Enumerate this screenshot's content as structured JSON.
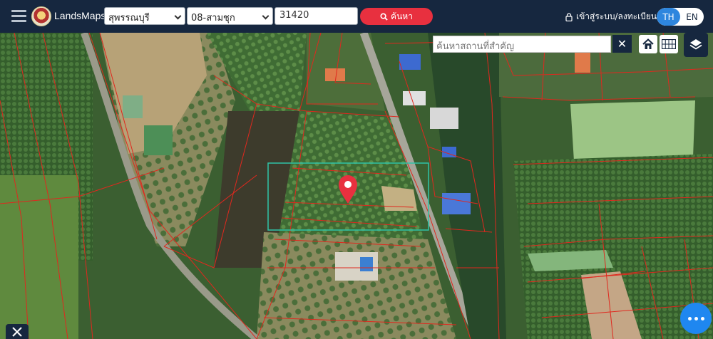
{
  "app": {
    "name": "LandsMaps"
  },
  "header": {
    "province": "สุพรรณบุรี",
    "amphoe": "08-สามชุก",
    "parcel_number": "31420",
    "search_label": "ค้นหา",
    "login_label": "เข้าสู่ระบบ/ลงทะเบียน",
    "lang_th": "TH",
    "lang_en": "EN"
  },
  "map": {
    "place_search_placeholder": "ค้นหาสถานที่สำคัญ",
    "clear_label": "✕",
    "controls": [
      "home-icon",
      "grid-icon",
      "layers-icon",
      "measure-tools-icon",
      "more-icon"
    ]
  },
  "colors": {
    "header_bg": "#16273f",
    "search_button": "#e8303f",
    "lang_active": "#2e86de",
    "parcel_lines": "#e0281e",
    "selection_box": "#2fc4a8",
    "marker": "#e8303f",
    "fab": "#1f87f0"
  }
}
